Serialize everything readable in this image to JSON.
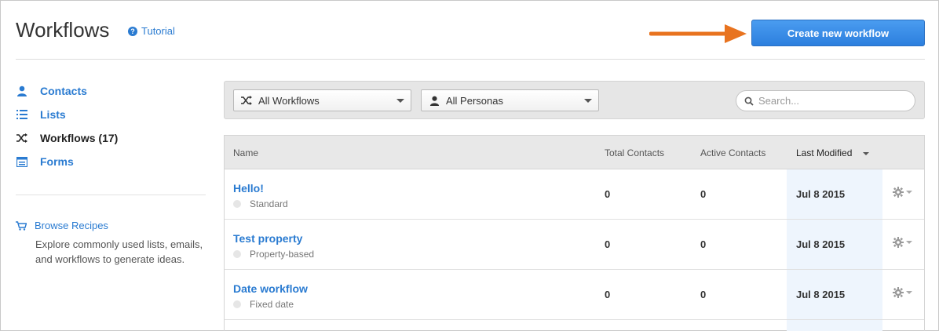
{
  "header": {
    "title": "Workflows",
    "tutorial_label": "Tutorial",
    "create_button_label": "Create new workflow"
  },
  "sidebar": {
    "items": [
      {
        "label": "Contacts",
        "icon": "person-icon",
        "active": false
      },
      {
        "label": "Lists",
        "icon": "list-icon",
        "active": false
      },
      {
        "label": "Workflows (17)",
        "icon": "shuffle-icon",
        "active": true
      },
      {
        "label": "Forms",
        "icon": "form-icon",
        "active": false
      }
    ],
    "recipes": {
      "link_label": "Browse Recipes",
      "description": "Explore commonly used lists, emails, and workflows to generate ideas."
    }
  },
  "filters": {
    "workflow_select": "All Workflows",
    "persona_select": "All Personas",
    "search_placeholder": "Search..."
  },
  "table": {
    "columns": [
      "Name",
      "Total Contacts",
      "Active Contacts",
      "Last Modified"
    ],
    "sorted_column": "Last Modified",
    "rows": [
      {
        "name": "Hello!",
        "type": "Standard",
        "total": "0",
        "active": "0",
        "modified": "Jul 8 2015"
      },
      {
        "name": "Test property",
        "type": "Property-based",
        "total": "0",
        "active": "0",
        "modified": "Jul 8 2015"
      },
      {
        "name": "Date workflow",
        "type": "Fixed date",
        "total": "0",
        "active": "0",
        "modified": "Jul 8 2015"
      }
    ]
  },
  "colors": {
    "accent": "#2a7bd1",
    "button": "#3a8ee8",
    "arrow": "#e8731f",
    "highlight_column": "#eef5fd"
  }
}
